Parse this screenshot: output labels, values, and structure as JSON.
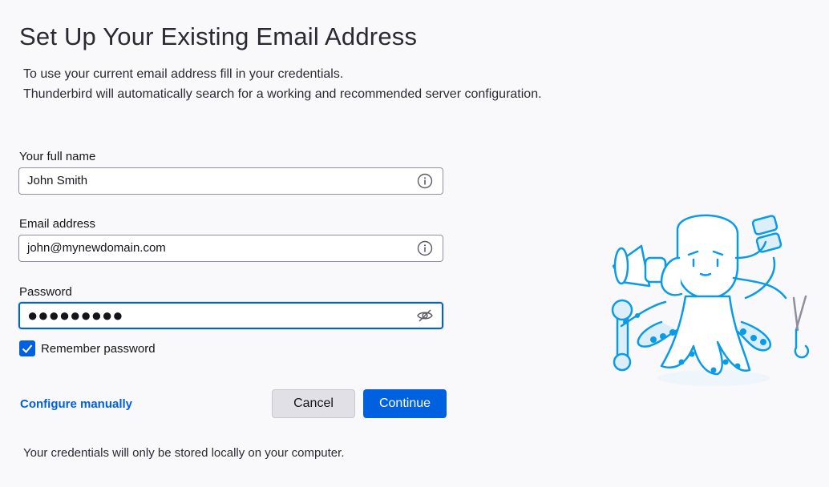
{
  "header": {
    "title": "Set Up Your Existing Email Address",
    "intro_line1": "To use your current email address fill in your credentials.",
    "intro_line2": "Thunderbird will automatically search for a working and recommended server configuration."
  },
  "form": {
    "full_name": {
      "label": "Your full name",
      "value": "John Smith",
      "icon": "info-icon"
    },
    "email": {
      "label": "Email address",
      "value": "john@mynewdomain.com",
      "icon": "info-icon"
    },
    "password": {
      "label": "Password",
      "value": "●●●●●●●●●",
      "icon": "eye-slash-icon"
    },
    "remember": {
      "label": "Remember password",
      "checked": true
    }
  },
  "actions": {
    "configure_manually": "Configure manually",
    "cancel": "Cancel",
    "continue": "Continue"
  },
  "footer": {
    "note": "Your credentials will only be stored locally on your computer."
  },
  "colors": {
    "accent": "#0061e0",
    "mascot_outline": "#0a9be8",
    "mascot_fill": "#ddeefb"
  }
}
